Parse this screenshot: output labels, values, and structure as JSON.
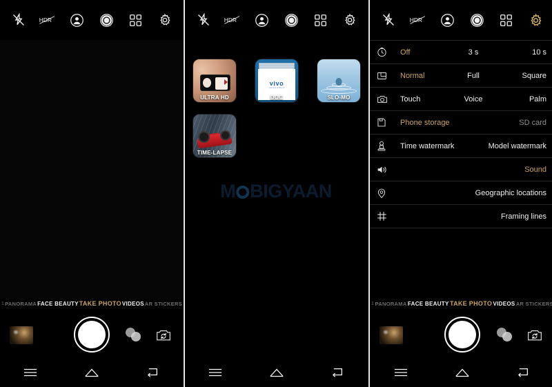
{
  "screenshot": {
    "watermark": {
      "text_before": "M",
      "logo": "ring-o",
      "text_after": "BIGYAAN"
    }
  },
  "toolbar": {
    "icons": [
      {
        "name": "flash-off-icon",
        "label": "Flash off"
      },
      {
        "name": "hdr-off-icon",
        "label": "HDR off"
      },
      {
        "name": "portrait-icon",
        "label": "Portrait"
      },
      {
        "name": "aperture-icon",
        "label": "Aperture"
      },
      {
        "name": "modes-grid-icon",
        "label": "Modes"
      },
      {
        "name": "settings-gear-icon",
        "label": "Settings"
      }
    ]
  },
  "modes_panel": {
    "tiles": [
      {
        "label": "ULTRA HD",
        "art": "phone-in-hand"
      },
      {
        "label": "DOC",
        "art": "document-vivo"
      },
      {
        "label": "SLO-MO",
        "art": "water-droplet"
      },
      {
        "label": "TIME-LAPSE",
        "art": "race-car"
      }
    ]
  },
  "settings_panel": {
    "rows": [
      {
        "icon": "timer-icon",
        "name": "timer",
        "options": [
          {
            "label": "Off",
            "state": "active"
          },
          {
            "label": "3 s",
            "state": "normal"
          },
          {
            "label": "10 s",
            "state": "normal"
          }
        ]
      },
      {
        "icon": "aspect-ratio-icon",
        "name": "aspect-ratio",
        "options": [
          {
            "label": "Normal",
            "state": "active"
          },
          {
            "label": "Full",
            "state": "normal"
          },
          {
            "label": "Square",
            "state": "normal"
          }
        ]
      },
      {
        "icon": "shutter-mode-icon",
        "name": "shutter-mode",
        "options": [
          {
            "label": "Touch",
            "state": "normal"
          },
          {
            "label": "Voice",
            "state": "normal"
          },
          {
            "label": "Palm",
            "state": "normal"
          }
        ]
      },
      {
        "icon": "storage-icon",
        "name": "storage",
        "options": [
          {
            "label": "Phone storage",
            "state": "active"
          },
          {
            "label": "SD card",
            "state": "dim"
          }
        ]
      },
      {
        "icon": "watermark-stamp-icon",
        "name": "watermark",
        "options": [
          {
            "label": "Time watermark",
            "state": "normal"
          },
          {
            "label": "Model watermark",
            "state": "normal"
          }
        ]
      },
      {
        "icon": "sound-icon",
        "name": "sound",
        "options": [
          {
            "label": "Sound",
            "state": "active"
          }
        ]
      },
      {
        "icon": "location-pin-icon",
        "name": "geographic-locations",
        "options": [
          {
            "label": "Geographic locations",
            "state": "normal"
          }
        ]
      },
      {
        "icon": "framing-lines-icon",
        "name": "framing-lines",
        "options": [
          {
            "label": "Framing lines",
            "state": "normal"
          }
        ]
      }
    ]
  },
  "mode_strip": {
    "items": [
      {
        "label": "1",
        "state": "edge"
      },
      {
        "label": "PANORAMA",
        "state": "faded"
      },
      {
        "label": "FACE BEAUTY",
        "state": "normal"
      },
      {
        "label": "TAKE PHOTO",
        "state": "active"
      },
      {
        "label": "VIDEOS",
        "state": "normal"
      },
      {
        "label": "AR STICKERS",
        "state": "faded"
      }
    ]
  },
  "capture_bar": {
    "thumbnail": "last-photo-thumbnail",
    "shutter": "shutter-button",
    "filter": "filter-button",
    "switch": "switch-camera-button"
  },
  "nav_bar": {
    "items": [
      {
        "name": "menu-icon",
        "label": "Recents"
      },
      {
        "name": "home-icon",
        "label": "Home"
      },
      {
        "name": "back-icon",
        "label": "Back"
      }
    ]
  },
  "colors": {
    "accent_gold": "#caa55c",
    "background": "#000000",
    "text": "#f0f0f0",
    "divider": "#262626",
    "watermark": "#0d1f33"
  }
}
